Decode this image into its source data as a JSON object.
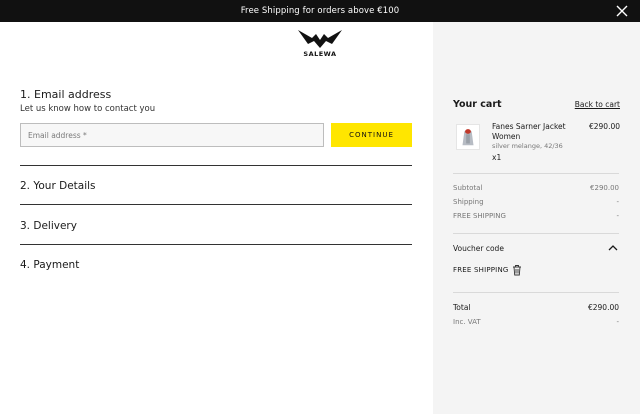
{
  "banner": {
    "text": "Free Shipping for orders above €100"
  },
  "logo": {
    "text": "SALEWA"
  },
  "steps": {
    "email": {
      "title": "1. Email address",
      "subtitle": "Let us know how to contact you",
      "placeholder": "Email address *",
      "continue_label": "CONTINUE"
    },
    "details": {
      "title": "2. Your Details"
    },
    "delivery": {
      "title": "3. Delivery"
    },
    "payment": {
      "title": "4. Payment"
    }
  },
  "cart": {
    "title": "Your cart",
    "back_label": "Back to cart",
    "product": {
      "name": "Fanes Sarner Jacket Women",
      "variant": "silver melange, 42/36",
      "qty": "x1",
      "price": "€290.00"
    },
    "summary": [
      {
        "label": "Subtotal",
        "value": "€290.00"
      },
      {
        "label": "Shipping",
        "value": "-"
      },
      {
        "label": "FREE SHIPPING",
        "value": "-"
      }
    ],
    "voucher": {
      "title": "Voucher code",
      "code": "FREE SHIPPING"
    },
    "total": {
      "label": "Total",
      "value": "€290.00"
    },
    "vat": {
      "label": "Inc. VAT",
      "value": "-"
    }
  },
  "colors": {
    "accent": "#ffe600",
    "banner": "#111111",
    "cart_bg": "#f4f4f4"
  }
}
